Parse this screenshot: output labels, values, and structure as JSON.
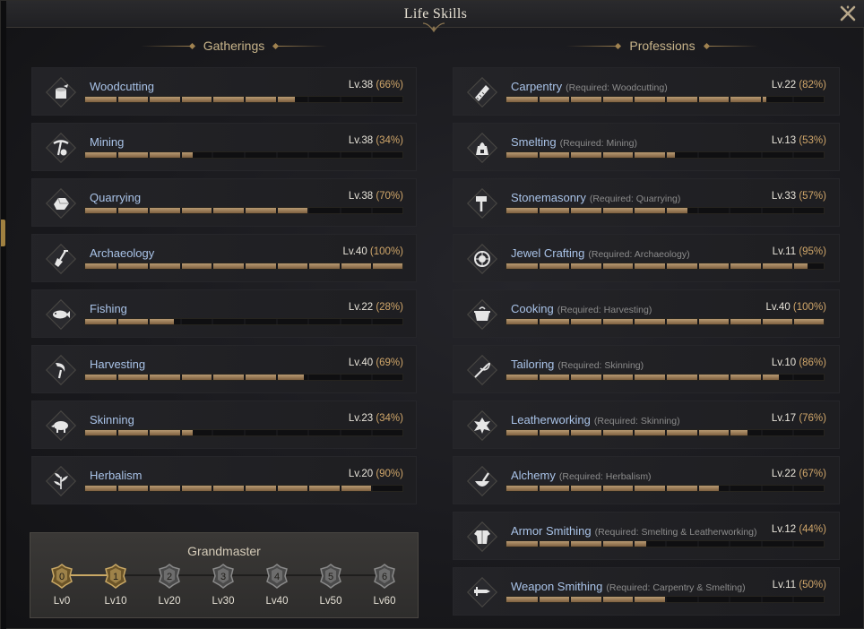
{
  "window": {
    "title": "Life Skills"
  },
  "sections": {
    "gatherings": "Gatherings",
    "professions": "Professions"
  },
  "gatherings": [
    {
      "name": "Woodcutting",
      "level": "Lv.38",
      "percent": "(66%)",
      "progress": 0.66,
      "icon": "log-icon"
    },
    {
      "name": "Mining",
      "level": "Lv.38",
      "percent": "(34%)",
      "progress": 0.34,
      "icon": "pickaxe-icon"
    },
    {
      "name": "Quarrying",
      "level": "Lv.38",
      "percent": "(70%)",
      "progress": 0.7,
      "icon": "stone-icon"
    },
    {
      "name": "Archaeology",
      "level": "Lv.40",
      "percent": "(100%)",
      "progress": 1.0,
      "icon": "shovel-icon"
    },
    {
      "name": "Fishing",
      "level": "Lv.22",
      "percent": "(28%)",
      "progress": 0.28,
      "icon": "fish-icon"
    },
    {
      "name": "Harvesting",
      "level": "Lv.40",
      "percent": "(69%)",
      "progress": 0.69,
      "icon": "sickle-icon"
    },
    {
      "name": "Skinning",
      "level": "Lv.23",
      "percent": "(34%)",
      "progress": 0.34,
      "icon": "boar-icon"
    },
    {
      "name": "Herbalism",
      "level": "Lv.20",
      "percent": "(90%)",
      "progress": 0.9,
      "icon": "leaf-icon"
    }
  ],
  "professions": [
    {
      "name": "Carpentry",
      "req": "(Required: Woodcutting)",
      "level": "Lv.22",
      "percent": "(82%)",
      "progress": 0.82,
      "icon": "saw-icon"
    },
    {
      "name": "Smelting",
      "req": "(Required: Mining)",
      "level": "Lv.13",
      "percent": "(53%)",
      "progress": 0.53,
      "icon": "furnace-icon"
    },
    {
      "name": "Stonemasonry",
      "req": "(Required: Quarrying)",
      "level": "Lv.33",
      "percent": "(57%)",
      "progress": 0.57,
      "icon": "hammer-icon"
    },
    {
      "name": "Jewel Crafting",
      "req": "(Required: Archaeology)",
      "level": "Lv.11",
      "percent": "(95%)",
      "progress": 0.95,
      "icon": "gem-icon"
    },
    {
      "name": "Cooking",
      "req": "(Required: Harvesting)",
      "level": "Lv.40",
      "percent": "(100%)",
      "progress": 1.0,
      "icon": "pot-icon"
    },
    {
      "name": "Tailoring",
      "req": "(Required: Skinning)",
      "level": "Lv.10",
      "percent": "(86%)",
      "progress": 0.86,
      "icon": "needle-icon"
    },
    {
      "name": "Leatherworking",
      "req": "(Required: Skinning)",
      "level": "Lv.17",
      "percent": "(76%)",
      "progress": 0.76,
      "icon": "hide-icon"
    },
    {
      "name": "Alchemy",
      "req": "(Required: Herbalism)",
      "level": "Lv.22",
      "percent": "(67%)",
      "progress": 0.67,
      "icon": "mortar-icon"
    },
    {
      "name": "Armor Smithing",
      "req": "(Required: Smelting & Leatherworking)",
      "level": "Lv.12",
      "percent": "(44%)",
      "progress": 0.44,
      "icon": "armor-icon"
    },
    {
      "name": "Weapon Smithing",
      "req": "(Required: Carpentry & Smelting)",
      "level": "Lv.11",
      "percent": "(50%)",
      "progress": 0.5,
      "icon": "sword-icon"
    }
  ],
  "grandmaster": {
    "title": "Grandmaster",
    "tiers": [
      {
        "rank": "0",
        "label": "Lv0",
        "unlocked": true
      },
      {
        "rank": "1",
        "label": "Lv10",
        "unlocked": true
      },
      {
        "rank": "2",
        "label": "Lv20",
        "unlocked": false
      },
      {
        "rank": "3",
        "label": "Lv30",
        "unlocked": false
      },
      {
        "rank": "4",
        "label": "Lv40",
        "unlocked": false
      },
      {
        "rank": "5",
        "label": "Lv50",
        "unlocked": false
      },
      {
        "rank": "6",
        "label": "Lv60",
        "unlocked": false
      }
    ]
  },
  "colors": {
    "accent": "#c9a865",
    "skill_name": "#a9c3e8",
    "percent": "#d0a66a",
    "bar_fill": "#b89a72"
  }
}
